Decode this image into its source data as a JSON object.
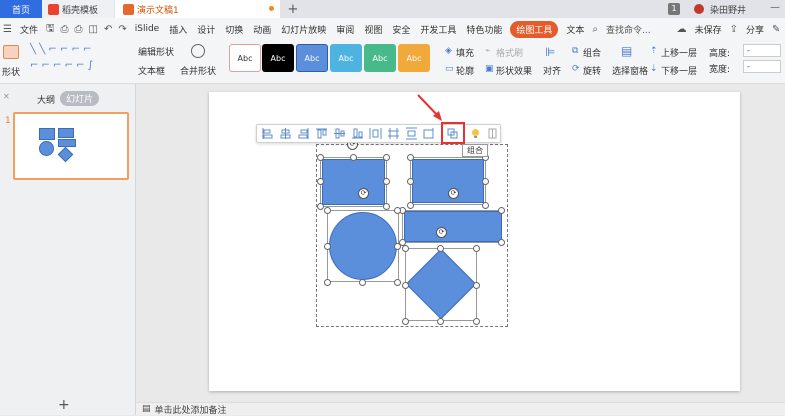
{
  "tabs": {
    "home": "首页",
    "template": "稻壳模板",
    "document": "演示文稿1",
    "add": "+"
  },
  "menu": {
    "file": "文件",
    "items": [
      "iSlide",
      "插入",
      "设计",
      "切换",
      "动画",
      "幻灯片放映",
      "审阅",
      "视图",
      "安全",
      "开发工具",
      "特色功能"
    ],
    "active": "绘图工具",
    "text_tool": "文本",
    "search": "查找命令...",
    "unsaved": "未保存",
    "share": "分享",
    "comment": "批注",
    "user": "染田野井",
    "badge": "1"
  },
  "ribbon": {
    "shape_label": "形状",
    "edit_shape": "编辑形状",
    "text_box": "文本框",
    "merge_shape": "合并形状",
    "style_samples": [
      "Abc",
      "Abc",
      "Abc",
      "Abc",
      "Abc",
      "Abc"
    ],
    "fill": "填充",
    "format_brush": "格式刷",
    "outline": "轮廓",
    "shape_effect": "形状效果",
    "align": "对齐",
    "group": "组合",
    "rotate": "旋转",
    "selection_pane": "选择窗格",
    "bring_forward": "上移一层",
    "send_backward": "下移一层",
    "height_label": "高度:",
    "width_label": "宽度:",
    "height_value": "-",
    "width_value": "-"
  },
  "left_panel": {
    "outline_tab": "大纲",
    "slides_tab": "幻灯片",
    "slide_number": "1",
    "add_slide": "+"
  },
  "canvas": {
    "tooltip": "组合",
    "notes_placeholder": "单击此处添加备注"
  },
  "colors": {
    "accent": "#2f6de1",
    "drawing_tool": "#e45c2c",
    "shape_fill": "#5b8fdb",
    "highlight": "#e53333"
  }
}
